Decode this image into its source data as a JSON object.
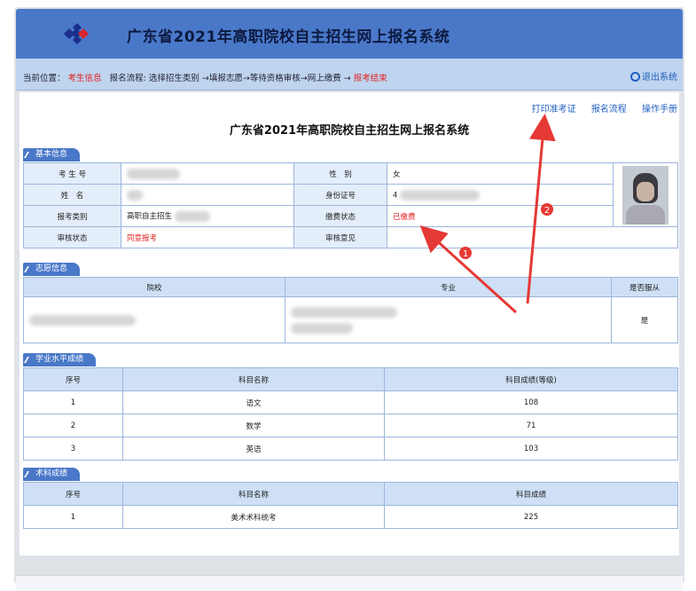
{
  "header": {
    "title": "广东省2021年高职院校自主招生网上报名系统"
  },
  "nav": {
    "location_label": "当前位置：",
    "location_value": "考生信息",
    "flow_label": "报名流程:",
    "flow_steps": "选择招生类别 →填报志愿→等待资格审核→网上缴费 →",
    "flow_end": "报考结束",
    "logout": "退出系统"
  },
  "links": {
    "print": "打印准考证",
    "flow": "报名流程",
    "manual": "操作手册"
  },
  "page_title": "广东省2021年高职院校自主招生网上报名系统",
  "basic": {
    "section": "基本信息",
    "exam_no_label": "考 生 号",
    "gender_label": "性　别",
    "gender_value": "女",
    "name_label": "姓　名",
    "id_label": "身份证号",
    "id_value": "4",
    "type_label": "报考类别",
    "type_value": "高职自主招生",
    "pay_label": "缴费状态",
    "pay_value": "已缴费",
    "review_label": "审核状态",
    "review_value": "同意报考",
    "opinion_label": "审核意见"
  },
  "volunteer": {
    "section": "志愿信息",
    "col_school": "院校",
    "col_major": "专业",
    "col_adjust": "是否服从",
    "adjust_value": "是"
  },
  "academic": {
    "section": "学业水平成绩",
    "col_no": "序号",
    "col_subject": "科目名称",
    "col_score": "科目成绩(等级)",
    "rows": [
      {
        "no": "1",
        "subject": "语文",
        "score": "108"
      },
      {
        "no": "2",
        "subject": "数学",
        "score": "71"
      },
      {
        "no": "3",
        "subject": "英语",
        "score": "103"
      }
    ]
  },
  "art": {
    "section": "术科成绩",
    "col_no": "序号",
    "col_subject": "科目名称",
    "col_score": "科目成绩",
    "rows": [
      {
        "no": "1",
        "subject": "美术术科统考",
        "score": "225"
      }
    ]
  },
  "annotations": {
    "marker1": "1",
    "marker2": "2"
  },
  "colors": {
    "header": "#4a78c9",
    "navbar": "#bfd4ee",
    "link": "#1f5fbf",
    "alert": "#e02020",
    "arrow": "#e53935"
  }
}
